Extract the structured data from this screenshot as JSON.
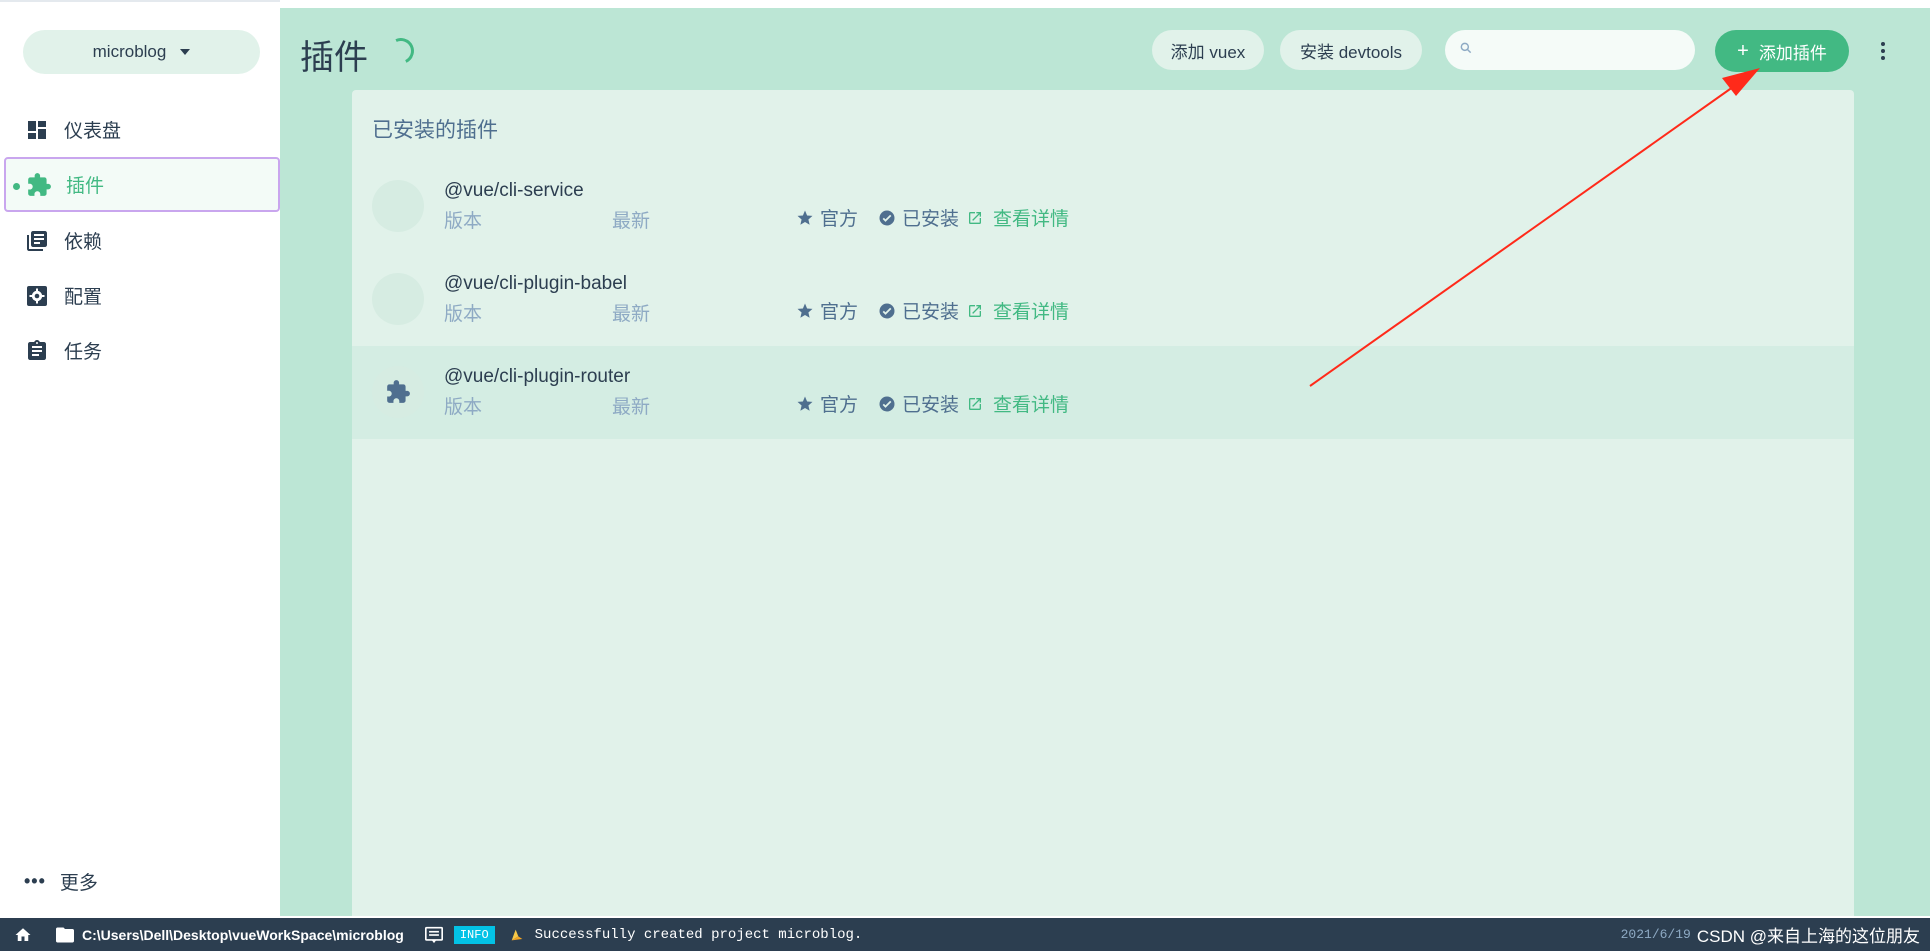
{
  "sidebar": {
    "project_name": "microblog",
    "nav_items": [
      {
        "label": "仪表盘",
        "icon": "dashboard-icon"
      },
      {
        "label": "插件",
        "icon": "puzzle-icon"
      },
      {
        "label": "依赖",
        "icon": "library-books-icon"
      },
      {
        "label": "配置",
        "icon": "settings-icon"
      },
      {
        "label": "任务",
        "icon": "assignment-icon"
      }
    ],
    "active_index": 1,
    "more_label": "更多"
  },
  "header": {
    "title": "插件",
    "add_vuex_label": "添加 vuex",
    "install_devtools_label": "安装 devtools",
    "search_placeholder": "",
    "add_plugin_label": "添加插件"
  },
  "panel": {
    "title": "已安装的插件",
    "plugins": [
      {
        "name": "@vue/cli-service",
        "version_label": "版本",
        "version_value": "最新",
        "official_label": "官方",
        "installed_label": "已安装",
        "details_label": "查看详情"
      },
      {
        "name": "@vue/cli-plugin-babel",
        "version_label": "版本",
        "version_value": "最新",
        "official_label": "官方",
        "installed_label": "已安装",
        "details_label": "查看详情"
      },
      {
        "name": "@vue/cli-plugin-router",
        "version_label": "版本",
        "version_value": "最新",
        "official_label": "官方",
        "installed_label": "已安装",
        "details_label": "查看详情"
      }
    ]
  },
  "status_bar": {
    "path": "C:\\Users\\Dell\\Desktop\\vueWorkSpace\\microblog",
    "log_level": "INFO",
    "message": "Successfully created project microblog.",
    "timestamp": "2021/6/19",
    "watermark": "CSDN @来自上海的这位朋友"
  },
  "colors": {
    "accent": "#42b983",
    "main_bg": "#bce6d5",
    "panel_bg": "#e1f2ea",
    "status_bar_bg": "#2c3e50",
    "annotation_arrow": "#ff2a1a"
  }
}
